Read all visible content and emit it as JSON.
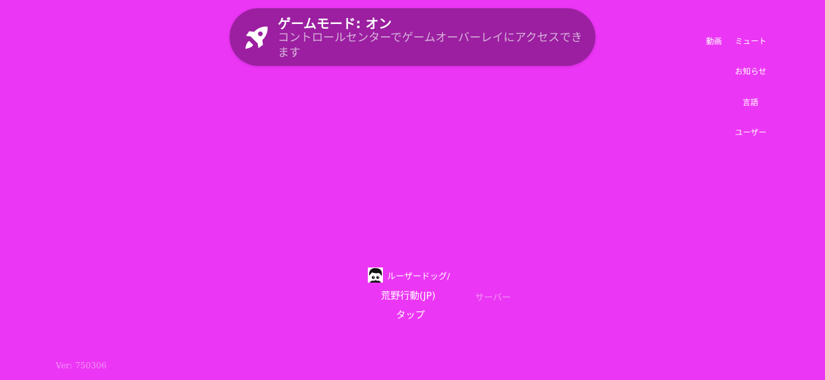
{
  "game_mode_toast": {
    "title": "ゲームモード: オン",
    "body": "コントロールセンターでゲームオーバーレイにアクセスできます",
    "icon": "rocket-icon"
  },
  "top_menu": {
    "video": "動画",
    "mute": "ミュート",
    "notice": "お知らせ",
    "language": "言語",
    "user": "ユーザー"
  },
  "login_panel": {
    "player_name": "ルーザードッグ/",
    "avatar": "chibi-character-avatar",
    "game_name": "荒野行動(JP)",
    "server_label": "サーバー",
    "tap_label": "タップ"
  },
  "footer": {
    "version": "Ver: 750306"
  },
  "colors": {
    "background": "#ec36f5",
    "toast_background": "#9b1fa0",
    "toast_body_text": "#d8b2dc",
    "muted_text": "#f098f6"
  }
}
